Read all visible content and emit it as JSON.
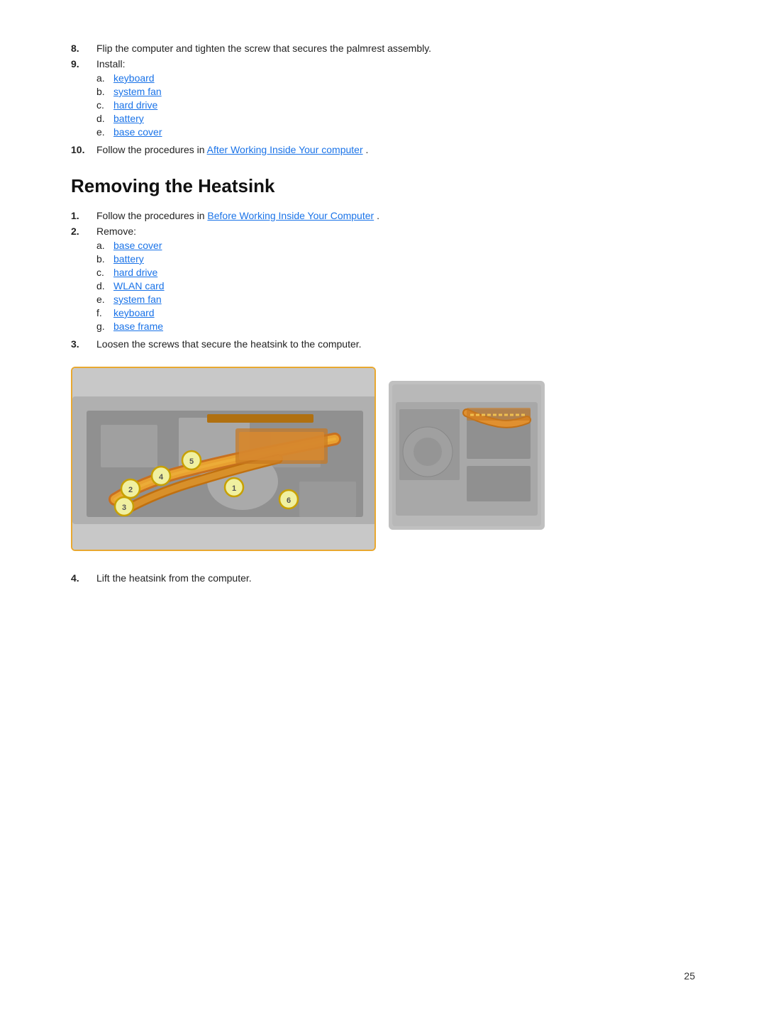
{
  "steps_section1": {
    "step8": {
      "num": "8.",
      "text": "Flip the computer and tighten the screw that secures the palmrest assembly."
    },
    "step9": {
      "num": "9.",
      "text": "Install:",
      "subs": [
        {
          "label": "a.",
          "text": "keyboard",
          "link": true
        },
        {
          "label": "b.",
          "text": "system fan",
          "link": true
        },
        {
          "label": "c.",
          "text": "hard drive",
          "link": true
        },
        {
          "label": "d.",
          "text": "battery",
          "link": true
        },
        {
          "label": "e.",
          "text": "base cover",
          "link": true
        }
      ]
    },
    "step10": {
      "num": "10.",
      "text": "Follow the procedures in ",
      "linkText": "After Working Inside Your computer",
      "textAfter": "."
    }
  },
  "section2": {
    "title": "Removing the Heatsink",
    "step1": {
      "num": "1.",
      "text": "Follow the procedures in ",
      "linkText": "Before Working Inside Your Computer",
      "textAfter": "."
    },
    "step2": {
      "num": "2.",
      "text": "Remove:",
      "subs": [
        {
          "label": "a.",
          "text": "base cover",
          "link": true
        },
        {
          "label": "b.",
          "text": "battery",
          "link": true
        },
        {
          "label": "c.",
          "text": "hard drive",
          "link": true
        },
        {
          "label": "d.",
          "text": "WLAN card",
          "link": true
        },
        {
          "label": "e.",
          "text": "system fan",
          "link": true
        },
        {
          "label": "f.",
          "text": "keyboard",
          "link": true
        },
        {
          "label": "g.",
          "text": "base frame",
          "link": true
        }
      ]
    },
    "step3": {
      "num": "3.",
      "text": "Loosen the screws that secure the heatsink to the computer."
    },
    "step4": {
      "num": "4.",
      "text": "Lift the heatsink from the computer."
    }
  },
  "page": {
    "number": "25"
  }
}
